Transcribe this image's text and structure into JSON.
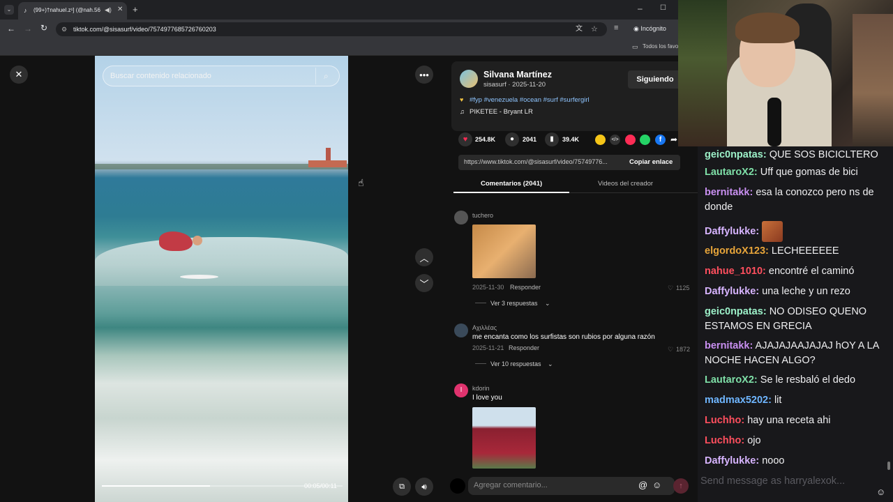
{
  "browser": {
    "tab_title": "(99+)†nahuel.z¹] (@nah.56",
    "url": "tiktok.com/@sisasurf/video/7574977685726760203",
    "incognito_label": "Incógnito",
    "bookmarks_label": "Todos los favo"
  },
  "video": {
    "search_placeholder": "Buscar contenido relacionado",
    "time": "00:05/00:11",
    "progress_fraction": 0.45
  },
  "author": {
    "name": "Silvana Martínez",
    "handle_date": "sisasurf · 2025-11-20",
    "follow_label": "Siguiendo",
    "hashtags": "#fyp #venezuela #ocean #surf #surfergirl",
    "music": "PIKETEE - Bryant LR"
  },
  "stats": {
    "likes": "254.8K",
    "comments": "2041",
    "saves": "39.4K"
  },
  "share": {
    "link": "https://www.tiktok.com/@sisasurf/video/75749776...",
    "copy_label": "Copiar enlace"
  },
  "tabs": {
    "comments": "Comentarios (2041)",
    "creator_videos": "Videos del creador"
  },
  "comments": [
    {
      "user": "tuchero",
      "date": "2025-11-30",
      "reply": "Responder",
      "likes": "1125",
      "replies": "Ver 3 respuestas"
    },
    {
      "user": "Αχιλλέας",
      "text": "me encanta como los surfistas son rubios por alguna razón",
      "date": "2025-11-21",
      "reply": "Responder",
      "likes": "1872",
      "replies": "Ver 10 respuestas"
    },
    {
      "user": "kdorin",
      "text": "I love you",
      "avatar_letter": "I"
    }
  ],
  "comment_input": {
    "placeholder": "Agregar comentario..."
  },
  "chat": {
    "messages": [
      {
        "user": "geic0npatas:",
        "text": "QUE SOS BICICLTERO",
        "color": "#9cf0c8"
      },
      {
        "user": "LautaroX2:",
        "text": "Uff que gomas de bici",
        "color": "#7fe0a8"
      },
      {
        "user": "bernitakk:",
        "text": "esa la conozco pero ns de donde",
        "color": "#c88ff0"
      },
      {
        "user": "Daffylukke:",
        "text": "",
        "color": "#d7b4ff"
      },
      {
        "user": "elgordoX123:",
        "text": "LECHEEEEEE",
        "color": "#e8a53a"
      },
      {
        "user": "nahue_1010:",
        "text": "encontré el caminó",
        "color": "#ff4f5e"
      },
      {
        "user": "Daffylukke:",
        "text": "una leche y un rezo",
        "color": "#d7b4ff"
      },
      {
        "user": "geic0npatas:",
        "text": "NO ODISEO QUENO ESTAMOS EN GRECIA",
        "color": "#9cf0c8"
      },
      {
        "user": "bernitakk:",
        "text": "AJAJAJAAJAJAJ hOY A LA NOCHE HACEN ALGO?",
        "color": "#c88ff0"
      },
      {
        "user": "LautaroX2:",
        "text": "Se le resbaló el dedo",
        "color": "#7fe0a8"
      },
      {
        "user": "madmax5202:",
        "text": "lit",
        "color": "#6fb6ff"
      },
      {
        "user": "Luchho:",
        "text": "hay una receta ahi",
        "color": "#ff4f5e"
      },
      {
        "user": "Luchho:",
        "text": "ojo",
        "color": "#ff4f5e"
      },
      {
        "user": "Daffylukke:",
        "text": "nooo",
        "color": "#d7b4ff"
      }
    ],
    "input_placeholder": "Send message as harryalexok..."
  },
  "colors": {
    "like": "#fe2c55",
    "accent": "#fe2c55",
    "chat_bg": "#18181b"
  }
}
